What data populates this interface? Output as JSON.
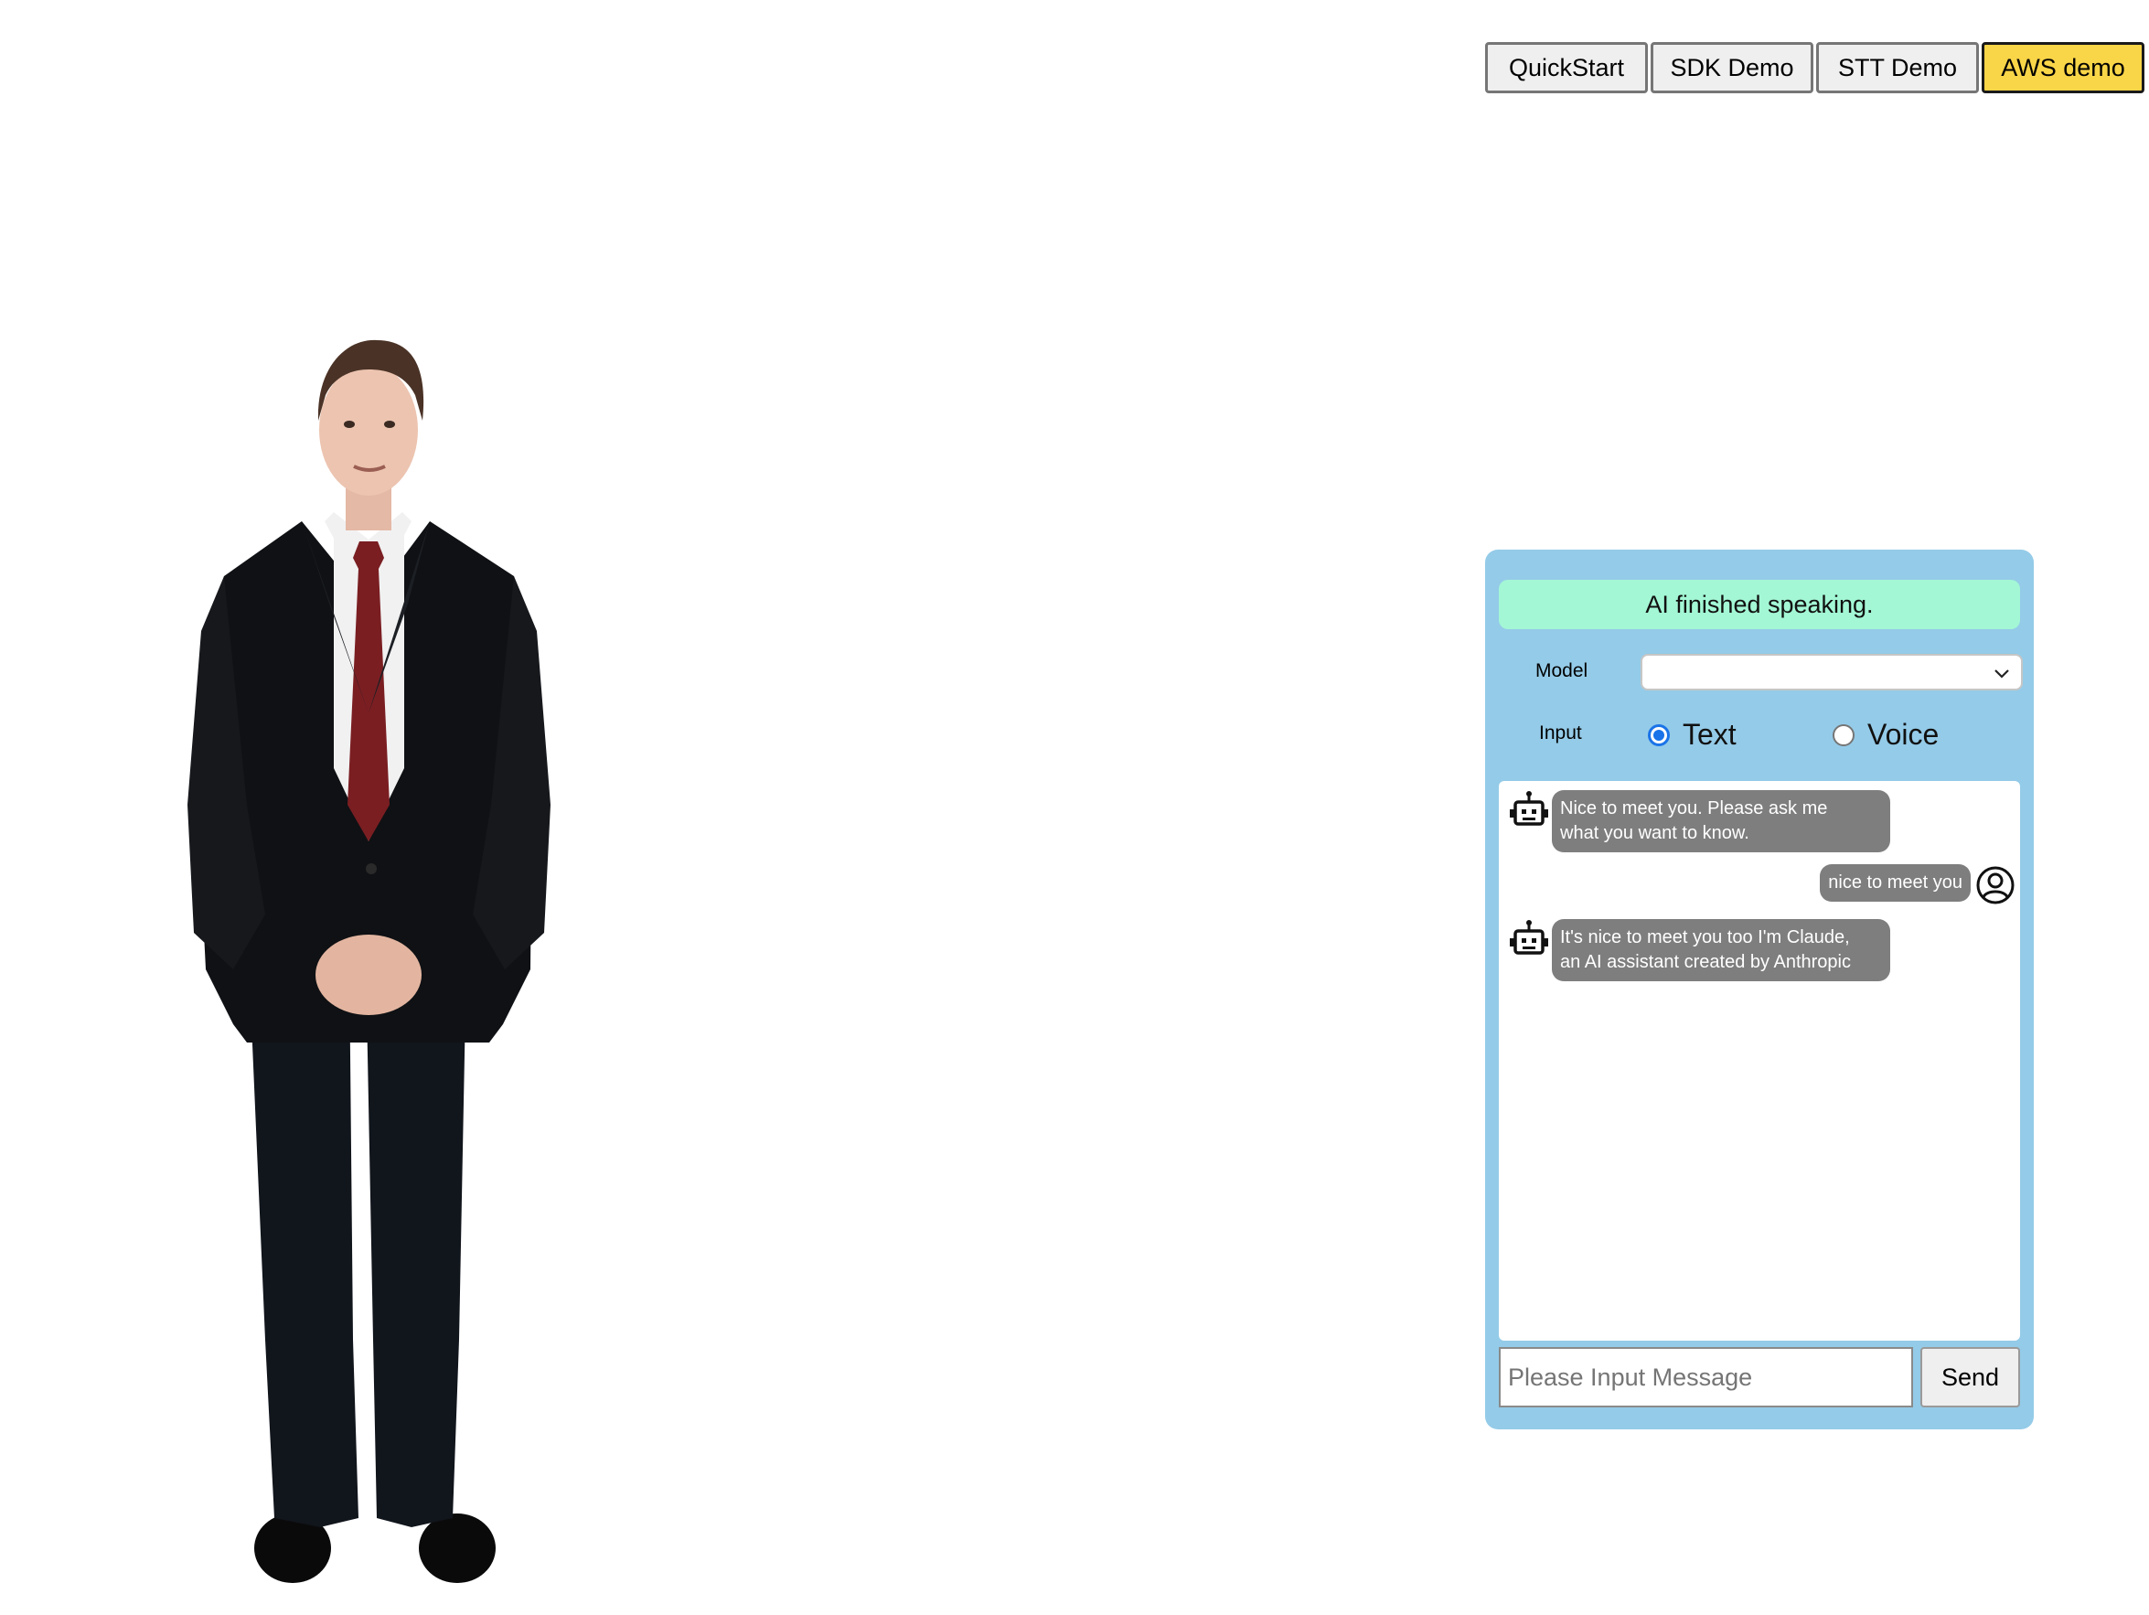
{
  "nav": {
    "items": [
      {
        "label": "QuickStart",
        "active": false
      },
      {
        "label": "SDK Demo",
        "active": false
      },
      {
        "label": "STT Demo",
        "active": false
      },
      {
        "label": "AWS demo",
        "active": true
      }
    ],
    "active_color": "#f9d548"
  },
  "chat": {
    "status": "AI finished speaking.",
    "model_label": "Model",
    "model_value": "",
    "input_label": "Input",
    "input_modes": [
      {
        "label": "Text",
        "selected": true
      },
      {
        "label": "Voice",
        "selected": false
      }
    ],
    "messages": [
      {
        "role": "bot",
        "icon": "robot-icon",
        "text": "Nice to meet you. Please ask me\nwhat you want to know."
      },
      {
        "role": "user",
        "icon": "user-circle-icon",
        "text": "nice to meet you"
      },
      {
        "role": "bot",
        "icon": "robot-icon",
        "text": "It's nice to meet you too I'm Claude,\nan AI assistant created by Anthropic"
      }
    ],
    "placeholder": "Please Input Message",
    "send_label": "Send",
    "panel_color": "#94cbe8",
    "status_color": "#a3f7d5"
  }
}
